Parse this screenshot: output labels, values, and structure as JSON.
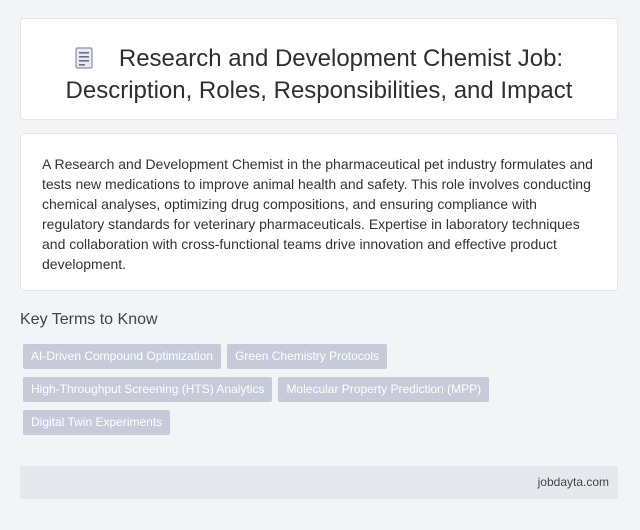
{
  "header": {
    "title_line1": "Research and Development Chemist Job:",
    "title_line2": "Description, Roles, Responsibilities, and Impact",
    "icon": "document-icon"
  },
  "description": "A Research and Development Chemist in the pharmaceutical pet industry formulates and tests new medications to improve animal health and safety. This role involves conducting chemical analyses, optimizing drug compositions, and ensuring compliance with regulatory standards for veterinary pharmaceuticals. Expertise in laboratory techniques and collaboration with cross-functional teams drive innovation and effective product development.",
  "key_terms": {
    "heading": "Key Terms to Know",
    "tags": [
      "AI-Driven Compound Optimization",
      "Green Chemistry Protocols",
      "High-Throughput Screening (HTS) Analytics",
      "Molecular Property Prediction (MPP)",
      "Digital Twin Experiments"
    ]
  },
  "footer": {
    "site": "jobdayta.com"
  },
  "colors": {
    "tag_bg": "#c7cad9",
    "footer_bg": "#e5e9ee",
    "page_bg": "#f3f4f6"
  }
}
